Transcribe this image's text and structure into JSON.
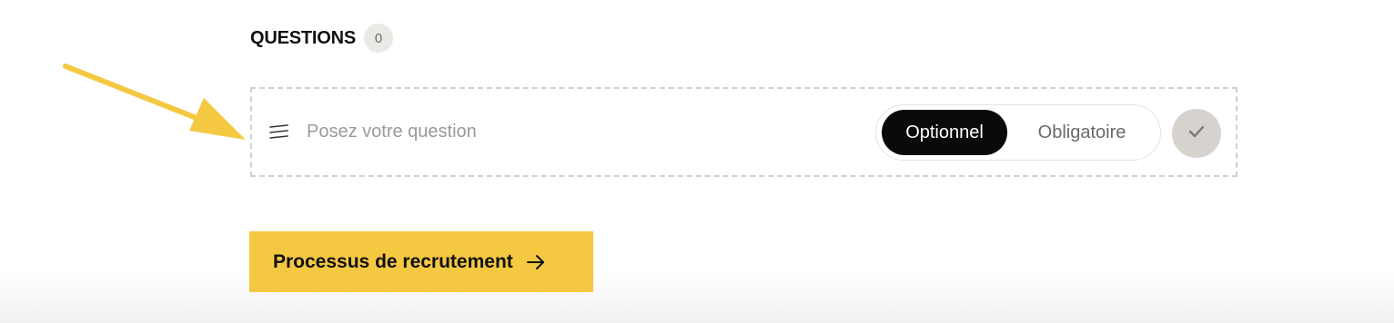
{
  "questions": {
    "title": "QUESTIONS",
    "count": "0"
  },
  "question_row": {
    "drag_icon": "drag-handle-icon",
    "placeholder": "Posez votre question",
    "value": "",
    "options": [
      {
        "label": "Optionnel",
        "selected": true
      },
      {
        "label": "Obligatoire",
        "selected": false
      }
    ],
    "confirm_icon": "checkmark-icon"
  },
  "cta": {
    "label": "Processus de recrutement",
    "icon": "arrow-right-icon"
  },
  "annotation": {
    "icon": "annotation-arrow-icon",
    "color": "#f5c842"
  },
  "colors": {
    "accent": "#f5c842",
    "toggle_active_bg": "#0a0a0a",
    "confirm_bg": "#d6d3cf"
  }
}
